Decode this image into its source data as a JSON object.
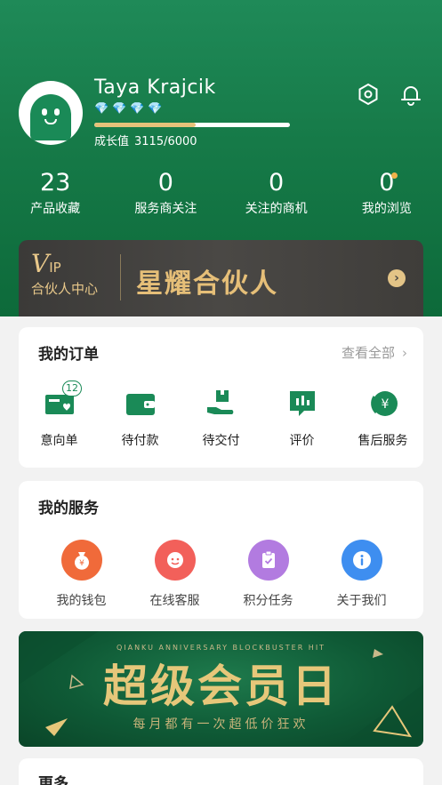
{
  "profile": {
    "name": "Taya Krajcik",
    "growth_label": "成长值",
    "growth_value": "3115/6000",
    "growth_progress": 0.52
  },
  "stats": [
    {
      "num": "23",
      "label": "产品收藏"
    },
    {
      "num": "0",
      "label": "服务商关注"
    },
    {
      "num": "0",
      "label": "关注的商机"
    },
    {
      "num": "0",
      "label": "我的浏览"
    }
  ],
  "vip": {
    "logo_v": "V",
    "logo_ip": "IP",
    "logo_center": "合伙人中心",
    "title": "星耀合伙人"
  },
  "orders": {
    "title": "我的订单",
    "see_all": "查看全部",
    "items": [
      {
        "label": "意向单",
        "icon": "intent-order-icon",
        "badge": "12"
      },
      {
        "label": "待付款",
        "icon": "wallet-icon"
      },
      {
        "label": "待交付",
        "icon": "delivery-icon"
      },
      {
        "label": "评价",
        "icon": "comment-icon"
      },
      {
        "label": "售后服务",
        "icon": "after-sales-icon"
      }
    ]
  },
  "services": {
    "title": "我的服务",
    "items": [
      {
        "label": "我的钱包",
        "icon": "money-bag-icon",
        "color": "#f06a3a"
      },
      {
        "label": "在线客服",
        "icon": "customer-service-icon",
        "color": "#f2605a"
      },
      {
        "label": "积分任务",
        "icon": "task-clipboard-icon",
        "color": "#b27be0"
      },
      {
        "label": "关于我们",
        "icon": "info-icon",
        "color": "#3e8ef0"
      }
    ]
  },
  "banner": {
    "en": "QIANKU ANNIVERSARY BLOCKBUSTER HIT",
    "title": "超级会员日",
    "subtitle": "每月都有一次超低价狂欢"
  },
  "more": {
    "title": "更多"
  },
  "colors": {
    "brand_green": "#1a8a57",
    "gold": "#e6bf78",
    "accent_dot": "#f0b24a"
  }
}
